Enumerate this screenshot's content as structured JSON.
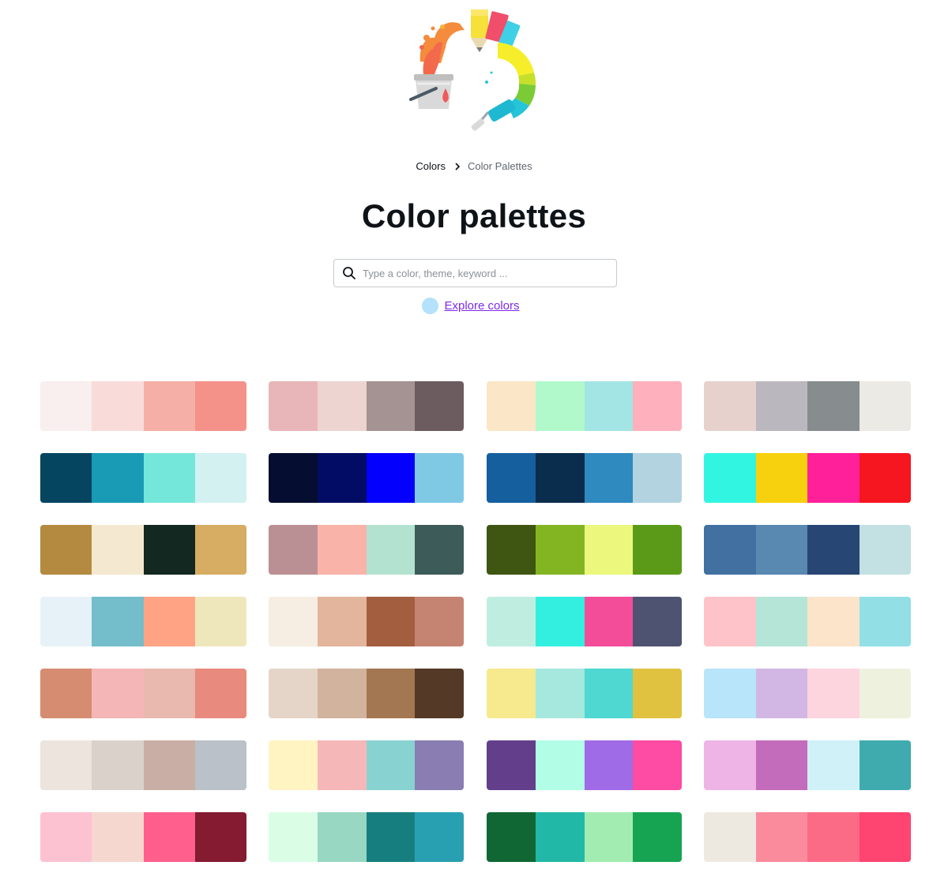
{
  "breadcrumb": {
    "items": [
      {
        "label": "Colors"
      },
      {
        "label": "Color Palettes"
      }
    ]
  },
  "page": {
    "title": "Color palettes"
  },
  "search": {
    "placeholder": "Type a color, theme, keyword ..."
  },
  "explore": {
    "label": "Explore colors",
    "dot_color": "#b4e1fb",
    "link_color": "#7d2ae8"
  },
  "palettes": [
    [
      "#f8efee",
      "#f9dcd9",
      "#f6afa6",
      "#f4928a"
    ],
    [
      "#e8b6b8",
      "#edd4d1",
      "#a49392",
      "#6c5b5f"
    ],
    [
      "#fbe6c7",
      "#b1f8cb",
      "#a3e5e4",
      "#feb0bc"
    ],
    [
      "#e6d1cc",
      "#bab8be",
      "#878c8e",
      "#eceae4"
    ],
    [
      "#064560",
      "#1a9bb5",
      "#75e6da",
      "#d3f1f1"
    ],
    [
      "#050d30",
      "#020c65",
      "#0400fd",
      "#80c9e5"
    ],
    [
      "#155f9f",
      "#0b2d4d",
      "#2f8abf",
      "#b3d3e1"
    ],
    [
      "#32f5e1",
      "#f7d10d",
      "#ff209a",
      "#f6161f"
    ],
    [
      "#b38a3f",
      "#f4e9d0",
      "#132820",
      "#d6ad62"
    ],
    [
      "#bb9094",
      "#f9b3a8",
      "#b4e2d1",
      "#3d5b59"
    ],
    [
      "#3e5611",
      "#83b522",
      "#ebf77d",
      "#5b9a19"
    ],
    [
      "#4270a1",
      "#5988b1",
      "#284674",
      "#c3e0e3"
    ],
    [
      "#e7f2f8",
      "#74bdcb",
      "#ffa384",
      "#efe7bc"
    ],
    [
      "#f6ede3",
      "#e3b59d",
      "#a35e3f",
      "#c58472"
    ],
    [
      "#bfeee1",
      "#33efdf",
      "#f34d99",
      "#4f5372"
    ],
    [
      "#fec3c8",
      "#b4e5d7",
      "#fbe4c9",
      "#93dfe6"
    ],
    [
      "#d68c70",
      "#f4b6b6",
      "#e9b8ae",
      "#e98a7f"
    ],
    [
      "#e4d5c8",
      "#d2b39d",
      "#a37751",
      "#533926"
    ],
    [
      "#f7e98d",
      "#a6e7de",
      "#4ed8d1",
      "#e0c240"
    ],
    [
      "#b8e5fa",
      "#d2b7e4",
      "#fdd5de",
      "#eff1df"
    ],
    [
      "#ede5dd",
      "#dad1ca",
      "#c9aea5",
      "#bac1c9"
    ],
    [
      "#fff4c2",
      "#f6b7b9",
      "#88d3d2",
      "#8a7db1"
    ],
    [
      "#633f8b",
      "#b2fde6",
      "#a06be6",
      "#fe4ba3"
    ],
    [
      "#eeb4e6",
      "#c36cbb",
      "#cff1f7",
      "#3fabae"
    ],
    [
      "#fdc2d1",
      "#f5d7cf",
      "#fe5f8d",
      "#841b30"
    ],
    [
      "#dafde6",
      "#98d7c2",
      "#177e80",
      "#29a0b2"
    ],
    [
      "#116733",
      "#22b8a7",
      "#a3ecb1",
      "#17a452"
    ],
    [
      "#eee9e0",
      "#fa8b9d",
      "#fc6b86",
      "#fe4470"
    ]
  ]
}
